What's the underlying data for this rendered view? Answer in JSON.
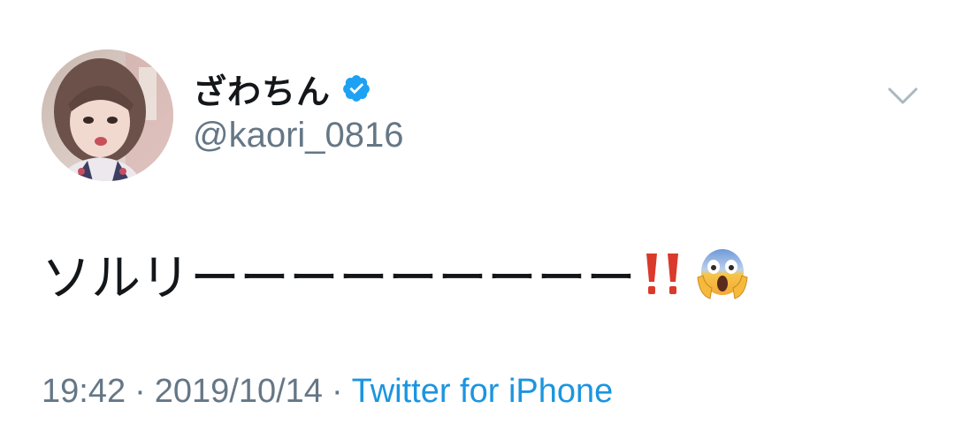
{
  "colors": {
    "text_primary": "#14171a",
    "text_secondary": "#657786",
    "link": "#1b95e0",
    "verified": "#1da1f2"
  },
  "user": {
    "display_name": "ざわちん",
    "handle": "@kaori_0816",
    "verified": true,
    "avatar_icon": "avatar-photo"
  },
  "menu": {
    "icon": "chevron-down-icon"
  },
  "tweet": {
    "text": "ソルリーーーーーーーーー",
    "emojis": [
      "double-exclamation-icon",
      "face-screaming-in-fear-icon"
    ]
  },
  "meta": {
    "time": "19:42",
    "separator": "·",
    "date": "2019/10/14",
    "source": "Twitter for iPhone"
  }
}
